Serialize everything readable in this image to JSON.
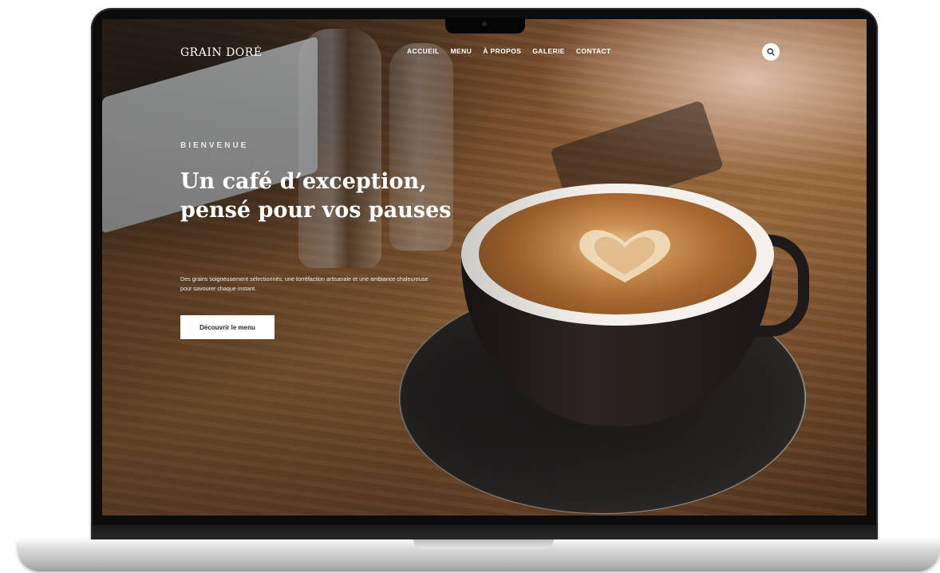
{
  "site": {
    "brand": "GRAIN DORÉ",
    "nav": [
      "ACCUEIL",
      "MENU",
      "À PROPOS",
      "GALERIE",
      "CONTACT"
    ],
    "search_icon": "search-icon"
  },
  "hero": {
    "eyebrow": "BIENVENUE",
    "title": "Un café d’exception, pensé pour vos pauses",
    "description": "Des grains soigneusement sélectionnés, une torréfaction artisanale et une ambiance chaleureuse pour savourer chaque instant.",
    "cta_label": "Découvrir le menu"
  },
  "colors": {
    "text_light": "#ffffff",
    "button_bg": "#ffffff",
    "button_text": "#2a2522"
  }
}
